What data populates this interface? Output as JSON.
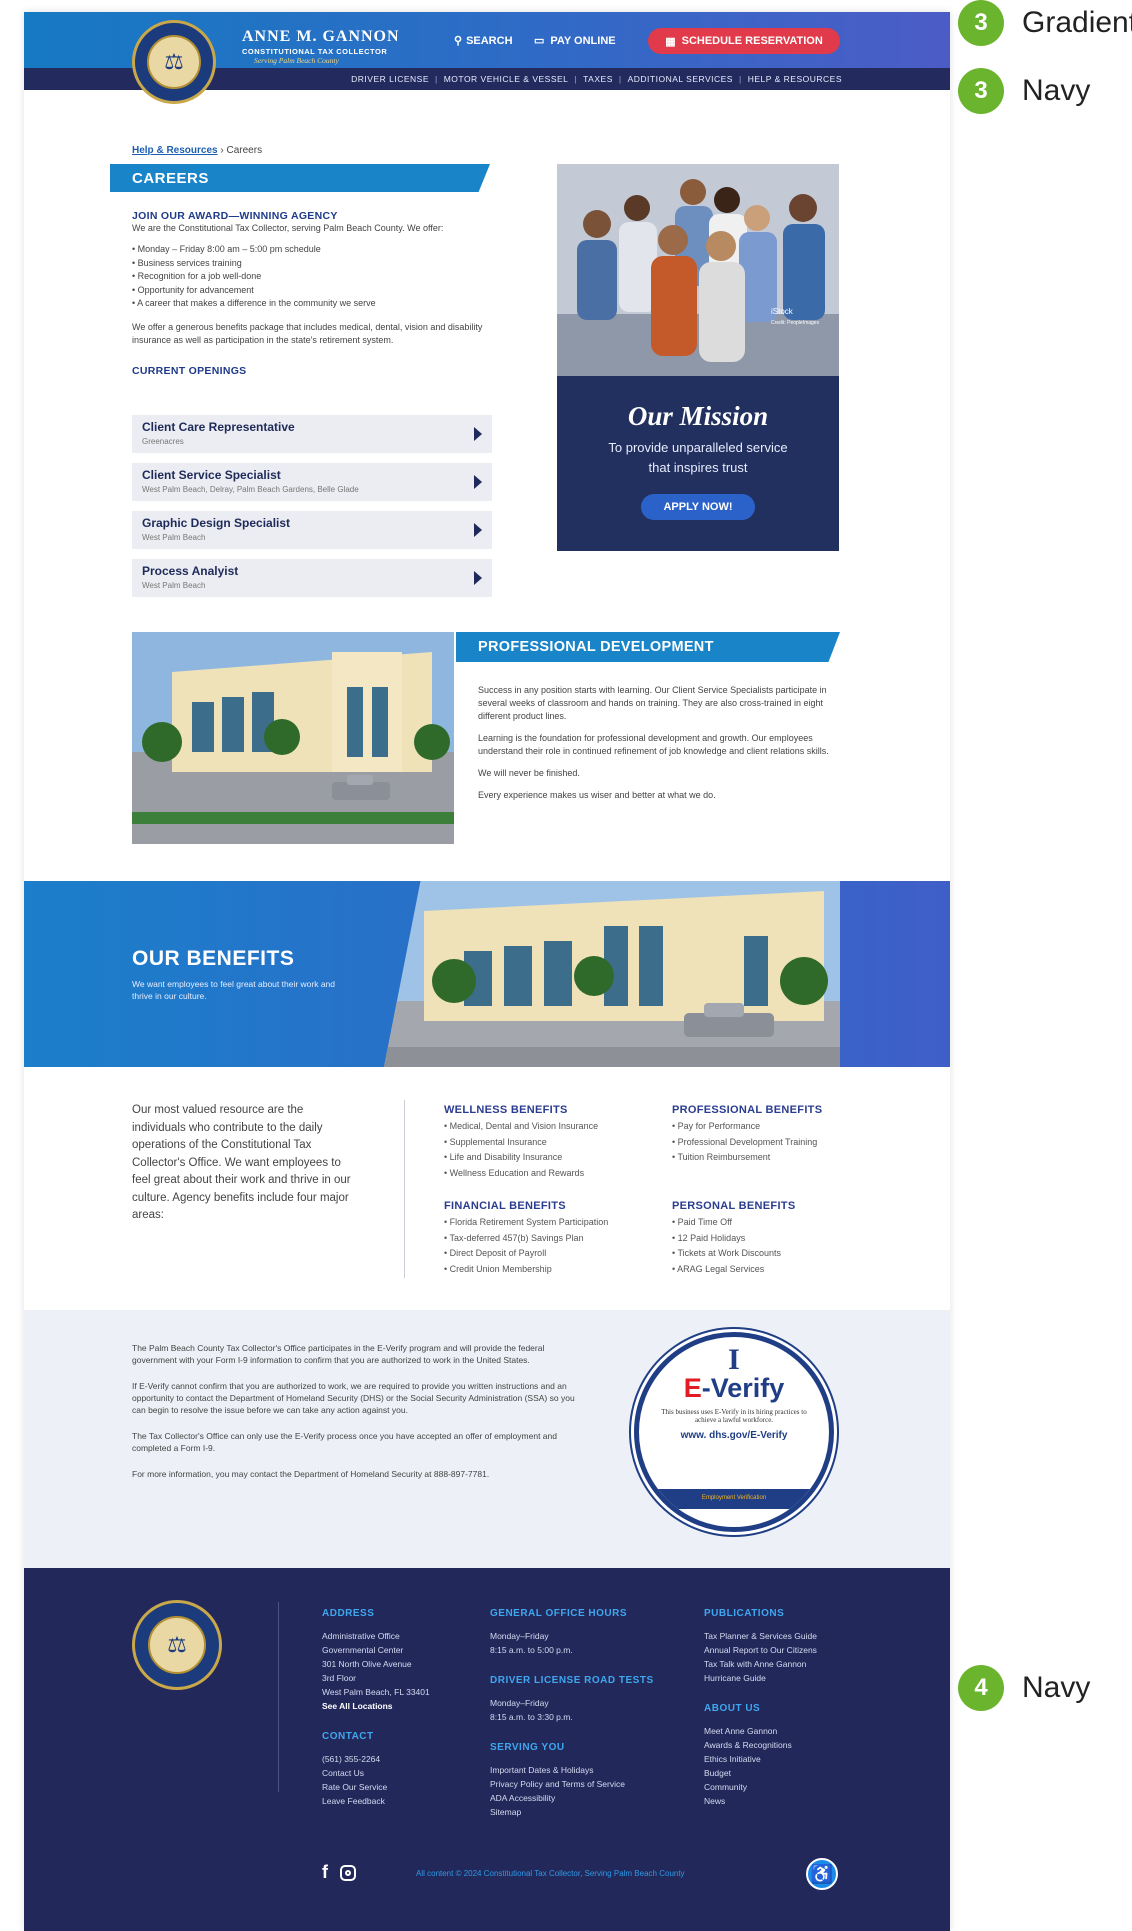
{
  "annotations": [
    {
      "num": "3",
      "label": "Gradient"
    },
    {
      "num": "3",
      "label": "Navy"
    },
    {
      "num": "4",
      "label": "Navy"
    }
  ],
  "header": {
    "brand_name": "ANNE M. GANNON",
    "brand_title": "CONSTITUTIONAL TAX COLLECTOR",
    "brand_sub": "Serving Palm Beach County",
    "search": "SEARCH",
    "pay": "PAY ONLINE",
    "reserve": "SCHEDULE RESERVATION",
    "nav": [
      "DRIVER LICENSE",
      "MOTOR VEHICLE & VESSEL",
      "TAXES",
      "ADDITIONAL SERVICES",
      "HELP & RESOURCES"
    ]
  },
  "breadcrumb": {
    "link": "Help & Resources",
    "sep": "›",
    "current": "Careers"
  },
  "careers": {
    "title": "CAREERS",
    "join_heading": "JOIN OUR AWARD—WINNING AGENCY",
    "join_text": "We are the Constitutional Tax Collector, serving Palm Beach County. We offer:",
    "offers": [
      "Monday – Friday 8:00 am – 5:00 pm schedule",
      "Business services training",
      "Recognition for a job well-done",
      "Opportunity for advancement",
      "A career that makes a difference in the community we serve"
    ],
    "benefits_text": "We offer a generous benefits package that includes medical, dental, vision and disability insurance as well as participation in the state's retirement system.",
    "openings_heading": "CURRENT OPENINGS",
    "openings": [
      {
        "title": "Client Care Representative",
        "location": "Greenacres"
      },
      {
        "title": "Client Service Specialist",
        "location": "West Palm Beach, Delray, Palm Beach Gardens, Belle Glade"
      },
      {
        "title": "Graphic Design Specialist",
        "location": "West Palm Beach"
      },
      {
        "title": "Process Analyist",
        "location": "West Palm Beach"
      }
    ]
  },
  "photo_credit": {
    "brand": "iStock",
    "credit": "Credit: PeopleImages"
  },
  "mission": {
    "title": "Our Mission",
    "text": "To provide unparalleled service that inspires trust",
    "button": "APPLY NOW!"
  },
  "prof_dev": {
    "title": "PROFESSIONAL DEVELOPMENT",
    "paragraphs": [
      "Success in any position starts with learning. Our Client Service Specialists participate in several weeks of classroom and hands on training. They are also cross-trained in eight different product lines.",
      "Learning is the foundation for professional development and growth. Our employees understand their role in continued refinement of job knowledge and client relations skills.",
      "We will never be finished.",
      "Every experience makes us wiser and better at what we do."
    ]
  },
  "benefits": {
    "title": "OUR BENEFITS",
    "subtitle": "We want employees to feel great about their work and thrive in our culture.",
    "intro": "Our most valued resource are the individuals who contribute to the daily operations of the Constitutional Tax Collector's Office. We want employees to feel great about their work and thrive in our culture. Agency benefits include four major areas:",
    "groups": [
      {
        "heading": "WELLNESS BENEFITS",
        "items": [
          "Medical, Dental and Vision Insurance",
          "Supplemental Insurance",
          "Life and Disability Insurance",
          "Wellness Education and Rewards"
        ]
      },
      {
        "heading": "PROFESSIONAL BENEFITS",
        "items": [
          "Pay for Performance",
          "Professional Development Training",
          "Tuition Reimbursement"
        ]
      },
      {
        "heading": "FINANCIAL BENEFITS",
        "items": [
          "Florida Retirement System Participation",
          "Tax-deferred 457(b) Savings Plan",
          "Direct Deposit of Payroll",
          "Credit Union Membership"
        ]
      },
      {
        "heading": "PERSONAL BENEFITS",
        "items": [
          "Paid Time Off",
          "12 Paid Holidays",
          "Tickets at Work Discounts",
          "ARAG Legal Services"
        ]
      }
    ]
  },
  "everify": {
    "paragraphs": [
      "The Palm Beach County Tax Collector's Office participates in the E-Verify program and will provide the federal government with your Form I-9 information to confirm that you are authorized to work in the United States.",
      "If E-Verify cannot confirm that you are authorized to work, we are required to provide you written instructions and an opportunity to contact the Department of Homeland Security (DHS) or the Social Security Administration (SSA) so you can begin to resolve the issue before we can take any action against you.",
      "The Tax Collector's Office can only use the E-Verify process once you have accepted an offer of employment and completed a Form I-9.",
      "For more information, you may contact the Department of Homeland Security at 888-897-7781."
    ],
    "logo_I": "I",
    "logo_e": "E",
    "logo_verify": "-Verify",
    "logo_text": "This business uses E-Verify in its hiring practices to achieve a lawful workforce.",
    "logo_url": "www. dhs.gov/E-Verify",
    "logo_bar": "Employment Verification"
  },
  "footer": {
    "address_h": "ADDRESS",
    "address": [
      "Administrative Office",
      "Governmental Center",
      "301 North Olive Avenue",
      "3rd Floor",
      "West Palm Beach, FL 33401"
    ],
    "address_link": "See All Locations",
    "contact_h": "CONTACT",
    "contact": [
      "(561) 355-2264",
      "Contact Us",
      "Rate Our Service",
      "Leave Feedback"
    ],
    "hours_h": "GENERAL OFFICE HOURS",
    "hours": [
      "Monday–Friday",
      "8:15 a.m. to 5:00 p.m."
    ],
    "dl_h": "DRIVER LICENSE ROAD TESTS",
    "dl": [
      "Monday–Friday",
      "8:15 a.m. to 3:30 p.m."
    ],
    "serving_h": "SERVING YOU",
    "serving": [
      "Important Dates & Holidays",
      "Privacy Policy and Terms of Service",
      "ADA Accessibility",
      "Sitemap"
    ],
    "pubs_h": "PUBLICATIONS",
    "pubs": [
      "Tax Planner & Services Guide",
      "Annual Report to Our Citizens",
      "Tax Talk with Anne Gannon",
      "Hurricane Guide"
    ],
    "about_h": "ABOUT US",
    "about": [
      "Meet Anne Gannon",
      "Awards & Recognitions",
      "Ethics Initiative",
      "Budget",
      "Community",
      "News"
    ],
    "copyright": "All content © 2024 Constitutional Tax Collector, Serving Palm Beach County",
    "facebook": "f"
  },
  "colors": {
    "gradient_start": "#1679c3",
    "gradient_end": "#4c5cc7",
    "navy": "#22295a",
    "accent_red": "#e13a4a",
    "band_blue": "#1a84c8"
  }
}
